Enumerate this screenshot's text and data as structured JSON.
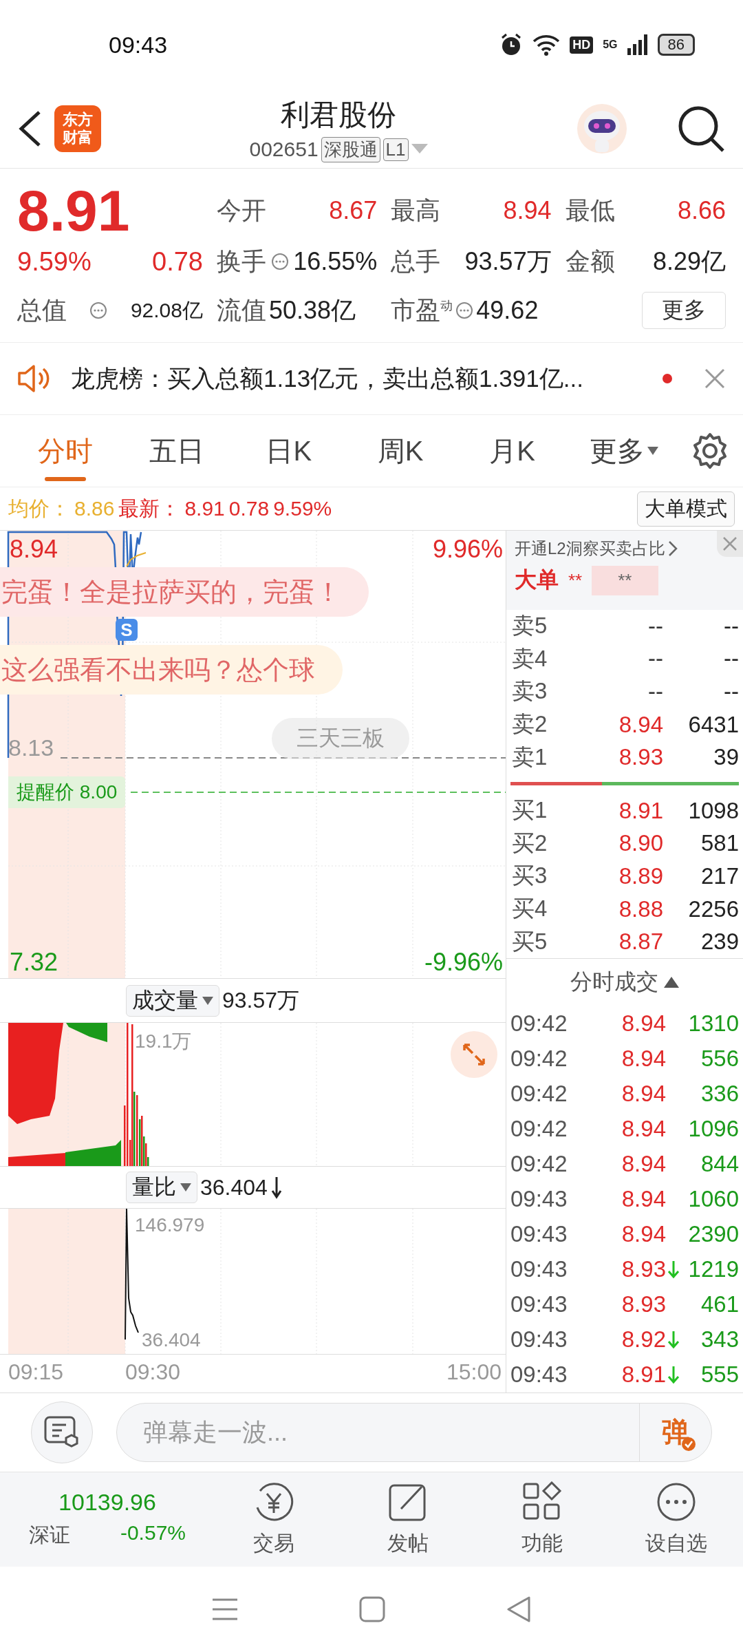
{
  "status_bar": {
    "time": "09:43",
    "hd": "HD",
    "network": "5G",
    "battery": "86"
  },
  "header": {
    "logo": [
      "东方",
      "财富"
    ],
    "title": "利君股份",
    "code": "002651",
    "tags": [
      "深股通",
      "L1"
    ]
  },
  "quote": {
    "price": "8.91",
    "change_pct": "9.59%",
    "change": "0.78",
    "total": {
      "label": "总值",
      "value": "92.08亿",
      "info": true
    },
    "stats": [
      {
        "label": "今开",
        "value": "8.67",
        "rising": true,
        "info": false
      },
      {
        "label": "最高",
        "value": "8.94",
        "rising": true,
        "info": false
      },
      {
        "label": "最低",
        "value": "8.66",
        "rising": true,
        "info": false
      },
      {
        "label": "换手",
        "value": "16.55%",
        "rising": false,
        "info": true
      },
      {
        "label": "总手",
        "value": "93.57万",
        "rising": false,
        "info": false
      },
      {
        "label": "金额",
        "value": "8.29亿",
        "rising": false,
        "info": false
      },
      {
        "label": "流值",
        "value": "50.38亿",
        "rising": false,
        "info": false
      },
      {
        "label": "市盈$^{动}$",
        "value": "49.62",
        "rising": false,
        "info": true
      }
    ],
    "more": "更多"
  },
  "banner": {
    "text": "龙虎榜：买入总额1.13亿元，卖出总额1.391亿...",
    "unread": true
  },
  "tabs": [
    {
      "label": "分时",
      "selected": true,
      "kind": "tab"
    },
    {
      "label": "五日",
      "selected": false,
      "kind": "tab"
    },
    {
      "label": "日K",
      "selected": false,
      "kind": "tab"
    },
    {
      "label": "周K",
      "selected": false,
      "kind": "tab"
    },
    {
      "label": "月K",
      "selected": false,
      "kind": "tab"
    },
    {
      "label": "更多",
      "selected": false,
      "kind": "menu"
    }
  ],
  "info_line": {
    "avg_label": "均价：",
    "avg": "8.86",
    "latest_label": "最新：",
    "latest": "8.91",
    "change": "0.78",
    "change_pct": "9.59%",
    "mode_button": "大单模式"
  },
  "price_chart": {
    "top_price": "8.94",
    "top_pct": "9.96%",
    "bottom_price": "7.32",
    "bottom_pct": "-9.96%",
    "prev_close": "8.13",
    "alert": "提醒价 8.00",
    "badge": "三天三板",
    "marker": "S",
    "danmaku": [
      {
        "text": "完蛋！全是拉萨买的，完蛋！",
        "color": "#fde8e8"
      },
      {
        "text": "这么强看不出来吗？怂个球",
        "color": "#fff4e4"
      }
    ]
  },
  "volume_panel": {
    "selector": "成交量",
    "value": "93.57万",
    "max_label": "19.1万"
  },
  "ratio_panel": {
    "selector": "量比",
    "value": "36.404",
    "falling": true,
    "max_label": "146.979",
    "current_label": "36.404"
  },
  "time_axis": [
    "09:15",
    "09:30",
    "15:00"
  ],
  "order_book": {
    "promo": "开通L2洞察买卖占比",
    "big_order": {
      "label": "大单",
      "buy": "**",
      "sell": "**"
    },
    "asks": [
      {
        "label": "卖5",
        "price": "--",
        "volume": "--",
        "rising": false
      },
      {
        "label": "卖4",
        "price": "--",
        "volume": "--",
        "rising": false
      },
      {
        "label": "卖3",
        "price": "--",
        "volume": "--",
        "rising": false
      },
      {
        "label": "卖2",
        "price": "8.94",
        "volume": "6431",
        "rising": true
      },
      {
        "label": "卖1",
        "price": "8.93",
        "volume": "39",
        "rising": true
      }
    ],
    "balance": {
      "level": 0.4
    },
    "bids": [
      {
        "label": "买1",
        "price": "8.91",
        "volume": "1098",
        "rising": true
      },
      {
        "label": "买2",
        "price": "8.90",
        "volume": "581",
        "rising": true
      },
      {
        "label": "买3",
        "price": "8.89",
        "volume": "217",
        "rising": true
      },
      {
        "label": "买4",
        "price": "8.88",
        "volume": "2256",
        "rising": true
      },
      {
        "label": "买5",
        "price": "8.87",
        "volume": "239",
        "rising": true
      }
    ]
  },
  "trades": {
    "title": "分时成交",
    "rows": [
      {
        "time": "09:42",
        "price": "8.94",
        "volume": "1310",
        "sell": true,
        "down": false
      },
      {
        "time": "09:42",
        "price": "8.94",
        "volume": "556",
        "sell": true,
        "down": false
      },
      {
        "time": "09:42",
        "price": "8.94",
        "volume": "336",
        "sell": true,
        "down": false
      },
      {
        "time": "09:42",
        "price": "8.94",
        "volume": "1096",
        "sell": true,
        "down": false
      },
      {
        "time": "09:42",
        "price": "8.94",
        "volume": "844",
        "sell": true,
        "down": false
      },
      {
        "time": "09:43",
        "price": "8.94",
        "volume": "1060",
        "sell": true,
        "down": false
      },
      {
        "time": "09:43",
        "price": "8.94",
        "volume": "2390",
        "sell": true,
        "down": false
      },
      {
        "time": "09:43",
        "price": "8.93",
        "volume": "1219",
        "sell": true,
        "down": true
      },
      {
        "time": "09:43",
        "price": "8.93",
        "volume": "461",
        "sell": true,
        "down": false
      },
      {
        "time": "09:43",
        "price": "8.92",
        "volume": "343",
        "sell": true,
        "down": true
      },
      {
        "time": "09:43",
        "price": "8.91",
        "volume": "555",
        "sell": true,
        "down": true
      }
    ]
  },
  "comment_bar": {
    "placeholder": "弹幕走一波...",
    "send": "弹"
  },
  "bottom_nav": {
    "index": {
      "name": "深证",
      "value": "10139.96",
      "change": "-0.57%",
      "falling": true
    },
    "items": [
      {
        "label": "交易"
      },
      {
        "label": "发帖"
      },
      {
        "label": "功能"
      },
      {
        "label": "设自选"
      }
    ]
  }
}
